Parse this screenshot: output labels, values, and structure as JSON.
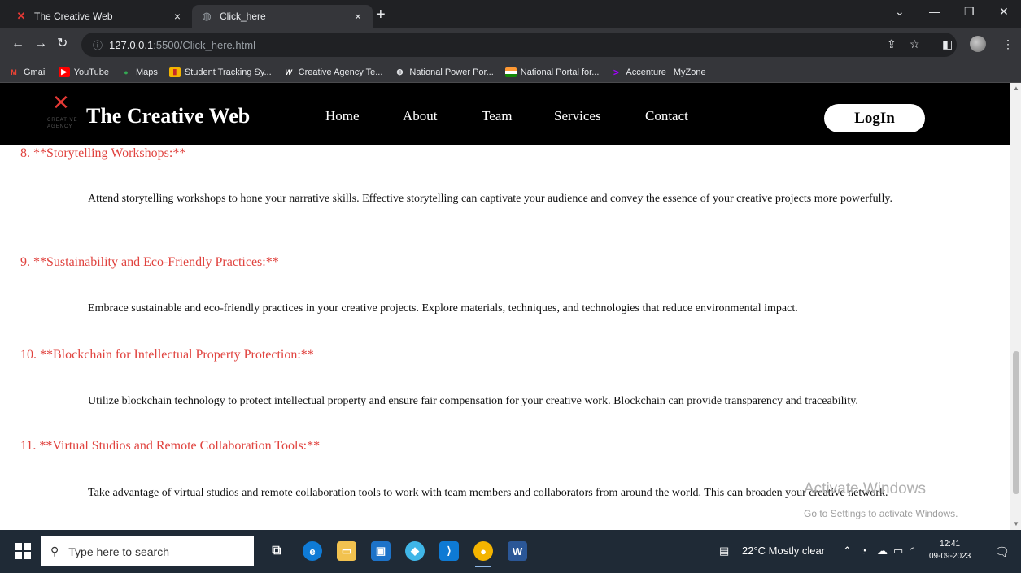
{
  "browser": {
    "tabs": [
      {
        "title": "The Creative Web",
        "favicon": "x-logo-icon",
        "active": false
      },
      {
        "title": "Click_here",
        "favicon": "globe-icon",
        "active": true
      }
    ],
    "url_host": "127.0.0.1",
    "url_path": ":5500/Click_here.html",
    "bookmarks": [
      {
        "label": "Gmail",
        "icon": "gmail-icon",
        "color": "#ea4335"
      },
      {
        "label": "YouTube",
        "icon": "youtube-icon",
        "color": "#ff0000"
      },
      {
        "label": "Maps",
        "icon": "maps-icon",
        "color": "#34a853"
      },
      {
        "label": "Student Tracking Sy...",
        "icon": "chart-icon",
        "color": "#f4b400"
      },
      {
        "label": "Creative Agency Te...",
        "icon": "w-icon",
        "color": "#35363a"
      },
      {
        "label": "National Power Por...",
        "icon": "globe-icon",
        "color": "#5f6368"
      },
      {
        "label": "National Portal for...",
        "icon": "india-flag-icon",
        "color": "#ff9933"
      },
      {
        "label": "Accenture | MyZone",
        "icon": "accenture-icon",
        "color": "#a100ff"
      }
    ]
  },
  "site": {
    "brand": "The Creative Web",
    "logo_sub": "CREATIVE AGENCY",
    "menu": [
      "Home",
      "About",
      "Team",
      "Services",
      "Contact"
    ],
    "login": "LogIn",
    "accent": "#e0433f"
  },
  "content": [
    {
      "heading": "8. **Storytelling Workshops:**",
      "text": "Attend storytelling workshops to hone your narrative skills. Effective storytelling can captivate your audience and convey the essence of your creative projects more powerfully."
    },
    {
      "heading": "9. **Sustainability and Eco-Friendly Practices:**",
      "text": "Embrace sustainable and eco-friendly practices in your creative projects. Explore materials, techniques, and technologies that reduce environmental impact."
    },
    {
      "heading": "10. **Blockchain for Intellectual Property Protection:**",
      "text": "Utilize blockchain technology to protect intellectual property and ensure fair compensation for your creative work. Blockchain can provide transparency and traceability."
    },
    {
      "heading": "11. **Virtual Studios and Remote Collaboration Tools:**",
      "text": "Take advantage of virtual studios and remote collaboration tools to work with team members and collaborators from around the world. This can broaden your creative network."
    }
  ],
  "watermark": {
    "title": "Activate Windows",
    "subtitle": "Go to Settings to activate Windows."
  },
  "taskbar": {
    "search_placeholder": "Type here to search",
    "weather": "22°C  Mostly clear",
    "time": "12:41",
    "date": "09-09-2023"
  }
}
